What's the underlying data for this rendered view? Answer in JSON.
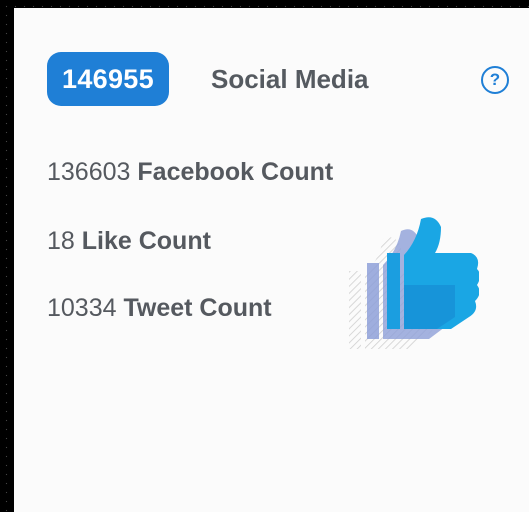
{
  "header": {
    "total": "146955",
    "title": "Social Media",
    "help_icon": "?"
  },
  "stats": [
    {
      "value": "136603",
      "label": "Facebook Count"
    },
    {
      "value": "18",
      "label": "Like Count"
    },
    {
      "value": "10334",
      "label": "Tweet Count"
    }
  ],
  "colors": {
    "accent": "#1f7fd6",
    "thumb_front": "#1aa1de",
    "thumb_back": "#7f96cf",
    "text": "#55595f"
  },
  "icons": {
    "illustration": "thumbs-up-icon",
    "help": "help-circle-icon"
  }
}
